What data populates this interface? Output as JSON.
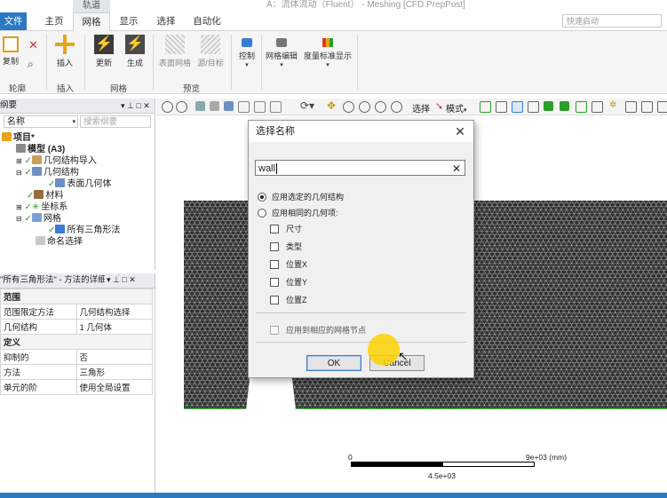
{
  "window": {
    "context_tab": "轨道",
    "title": "A：流体流动（Fluent） - Meshing [CFD PrepPost]",
    "quick_start_placeholder": "快速启动"
  },
  "ribbon_tabs": [
    {
      "label": "文件",
      "state": "file"
    },
    {
      "label": "主页",
      "state": "normal"
    },
    {
      "label": "网格",
      "state": "active"
    },
    {
      "label": "显示",
      "state": "normal"
    },
    {
      "label": "选择",
      "state": "normal"
    },
    {
      "label": "自动化",
      "state": "normal"
    }
  ],
  "ribbon": {
    "copy": "复制",
    "outline_group": "轮廓",
    "insert": "插入",
    "insert_group": "插入",
    "update": "更新",
    "generate": "生成",
    "mesh_group": "网格",
    "surface_mesh": "表面网格",
    "source_target": "源/目标",
    "preview_group": "预览",
    "control": "控制",
    "mesh_edit": "网格编辑",
    "metric_display": "度量标准显示"
  },
  "tree_panel": {
    "header": "纲要",
    "name_column": "名称",
    "search_placeholder": "搜索纲要",
    "items": [
      {
        "label": "项目*"
      },
      {
        "label": "模型 (A3)"
      },
      {
        "label": "几何结构导入"
      },
      {
        "label": "几何结构"
      },
      {
        "label": "表面几何体"
      },
      {
        "label": "材料"
      },
      {
        "label": "坐标系"
      },
      {
        "label": "网格"
      },
      {
        "label": "所有三角形法"
      },
      {
        "label": "命名选择"
      }
    ]
  },
  "details_panel": {
    "header": "\"所有三角形法\" - 方法的详细信息",
    "sections": [
      {
        "title": "范围",
        "rows": [
          {
            "key": "范围限定方法",
            "value": "几何结构选择"
          },
          {
            "key": "几何结构",
            "value": "1 几何体"
          }
        ]
      },
      {
        "title": "定义",
        "rows": [
          {
            "key": "抑制的",
            "value": "否"
          },
          {
            "key": "方法",
            "value": "三角形"
          },
          {
            "key": "单元的阶",
            "value": "使用全局设置"
          }
        ]
      }
    ]
  },
  "viewport_toolbar": {
    "select_label": "选择",
    "mode_label": "模式"
  },
  "scale_bar": {
    "start": "0",
    "end": "9e+03 (mm)",
    "mid": "4.5e+03"
  },
  "dialog": {
    "title": "选择名称",
    "input_value": "wall",
    "radio_selected_geometry": "应用选定的几何结构",
    "radio_same_geometry": "应用相同的几何项:",
    "checks": [
      "尺寸",
      "类型",
      "位置X",
      "位置Y",
      "位置Z"
    ],
    "apply_mesh_nodes": "应用到相应的网格节点",
    "ok": "OK",
    "cancel": "Cancel"
  },
  "colors": {
    "accent": "#2b79c2",
    "mesh": "#2e2e2e",
    "green_check": "#2a9d2a",
    "cursor_halo": "#f6cf00"
  }
}
